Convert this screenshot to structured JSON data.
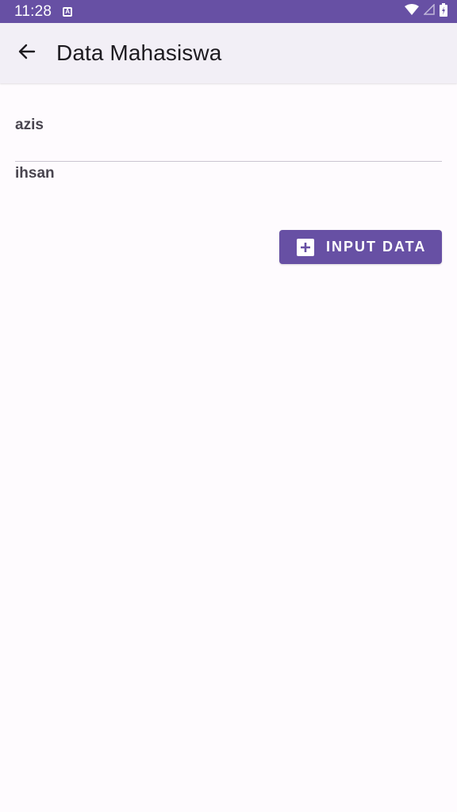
{
  "status_bar": {
    "time": "11:28",
    "notification_icon_label": "A",
    "icons": [
      "wifi-icon",
      "signal-icon",
      "battery-charging-icon"
    ]
  },
  "app_bar": {
    "title": "Data Mahasiswa",
    "back_icon": "arrow-back-icon"
  },
  "list": {
    "items": [
      {
        "name": "azis"
      },
      {
        "name": "ihsan"
      }
    ]
  },
  "actions": {
    "input_button_label": "INPUT DATA",
    "input_button_icon": "add-box-icon"
  },
  "colors": {
    "primary": "#6750a4",
    "app_bar_bg": "#f2eff6",
    "background": "#fefbfe",
    "text": "#1d1b20",
    "list_text": "#49454f",
    "divider": "#cac4d0"
  }
}
